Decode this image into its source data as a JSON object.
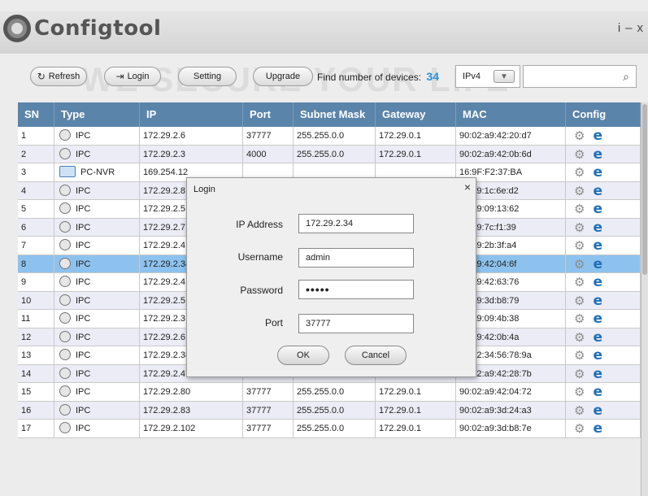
{
  "app": {
    "title": "Configtool",
    "controls": {
      "info": "i",
      "minimize": "–",
      "close": "x"
    },
    "watermark": "WE SECURE YOUR LIFE"
  },
  "toolbar": {
    "refresh_label": "Refresh",
    "login_label": "Login",
    "setting_label": "Setting",
    "upgrade_label": "Upgrade",
    "find_label": "Find number of devices:",
    "device_count": "34",
    "ip_version": "IPv4",
    "search_value": ""
  },
  "table": {
    "columns": [
      "SN",
      "Type",
      "IP",
      "Port",
      "Subnet Mask",
      "Gateway",
      "MAC",
      "Config"
    ],
    "selected_sn": "8",
    "rows": [
      {
        "sn": "1",
        "type": "IPC",
        "ip": "172.29.2.6",
        "port": "37777",
        "mask": "255.255.0.0",
        "gateway": "172.29.0.1",
        "mac": "90:02:a9:42:20:d7"
      },
      {
        "sn": "2",
        "type": "IPC",
        "ip": "172.29.2.3",
        "port": "4000",
        "mask": "255.255.0.0",
        "gateway": "172.29.0.1",
        "mac": "90:02:a9:42:0b:6d"
      },
      {
        "sn": "3",
        "type": "PC-NVR",
        "ip": "169.254.12",
        "port": "",
        "mask": "",
        "gateway": "",
        "mac": "16:9F:F2:37:BA"
      },
      {
        "sn": "4",
        "type": "IPC",
        "ip": "172.29.2.8",
        "port": "",
        "mask": "",
        "gateway": "",
        "mac": "02:a9:1c:6e:d2"
      },
      {
        "sn": "5",
        "type": "IPC",
        "ip": "172.29.2.5",
        "port": "",
        "mask": "",
        "gateway": "",
        "mac": "02:a9:09:13:62"
      },
      {
        "sn": "6",
        "type": "IPC",
        "ip": "172.29.2.7",
        "port": "",
        "mask": "",
        "gateway": "",
        "mac": "02:a9:7c:f1:39"
      },
      {
        "sn": "7",
        "type": "IPC",
        "ip": "172.29.2.4",
        "port": "",
        "mask": "",
        "gateway": "",
        "mac": "02:a9:2b:3f:a4"
      },
      {
        "sn": "8",
        "type": "IPC",
        "ip": "172.29.2.34",
        "port": "",
        "mask": "",
        "gateway": "",
        "mac": "02:a9:42:04:6f"
      },
      {
        "sn": "9",
        "type": "IPC",
        "ip": "172.29.2.4",
        "port": "",
        "mask": "",
        "gateway": "",
        "mac": "02:a9:42:63:76"
      },
      {
        "sn": "10",
        "type": "IPC",
        "ip": "172.29.2.5",
        "port": "",
        "mask": "",
        "gateway": "",
        "mac": "02:a9:3d:b8:79"
      },
      {
        "sn": "11",
        "type": "IPC",
        "ip": "172.29.2.3",
        "port": "",
        "mask": "",
        "gateway": "",
        "mac": "02:a9:09:4b:38"
      },
      {
        "sn": "12",
        "type": "IPC",
        "ip": "172.29.2.6",
        "port": "",
        "mask": "",
        "gateway": "",
        "mac": "02:a9:42:0b:4a"
      },
      {
        "sn": "13",
        "type": "IPC",
        "ip": "172.29.2.38",
        "port": "37777",
        "mask": "255.255.0.0",
        "gateway": "172.29.0.1",
        "mac": "00:12:34:56:78:9a"
      },
      {
        "sn": "14",
        "type": "IPC",
        "ip": "172.29.2.47",
        "port": "37777",
        "mask": "255.255.0.0",
        "gateway": "172.29.0.1",
        "mac": "90:02:a9:42:28:7b"
      },
      {
        "sn": "15",
        "type": "IPC",
        "ip": "172.29.2.80",
        "port": "37777",
        "mask": "255.255.0.0",
        "gateway": "172.29.0.1",
        "mac": "90:02:a9:42:04:72"
      },
      {
        "sn": "16",
        "type": "IPC",
        "ip": "172.29.2.83",
        "port": "37777",
        "mask": "255.255.0.0",
        "gateway": "172.29.0.1",
        "mac": "90:02:a9:3d:24:a3"
      },
      {
        "sn": "17",
        "type": "IPC",
        "ip": "172.29.2.102",
        "port": "37777",
        "mask": "255.255.0.0",
        "gateway": "172.29.0.1",
        "mac": "90:02:a9:3d:b8:7e"
      }
    ]
  },
  "login_dialog": {
    "title": "Login",
    "close": "×",
    "ip_label": "IP Address",
    "ip_value": "172.29.2.34",
    "username_label": "Username",
    "username_value": "admin",
    "password_label": "Password",
    "password_value": "•••••",
    "port_label": "Port",
    "port_value": "37777",
    "ok_label": "OK",
    "cancel_label": "Cancel"
  },
  "colors": {
    "header_bg": "#5b84aa",
    "selected_row": "#8dc2ee",
    "device_count": "#2a8fd6",
    "web_icon": "#1f6fb8"
  }
}
